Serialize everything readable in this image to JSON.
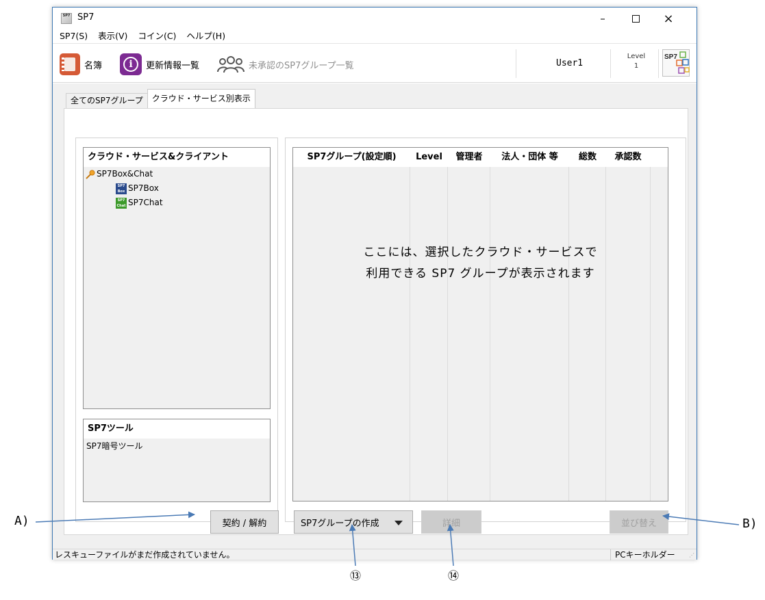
{
  "window": {
    "title": "SP7",
    "app_icon_text": "SP7",
    "controls": {
      "minimize": "–",
      "close": "×"
    }
  },
  "menu": [
    "SP7(S)",
    "表示(V)",
    "コイン(C)",
    "ヘルプ(H)"
  ],
  "toolbar": {
    "directory_label": "名簿",
    "updates_label": "更新情報一覧",
    "pending_groups_label": "未承認のSP7グループ一覧",
    "user_name": "User1",
    "level_label": "Level",
    "level_value": "1",
    "logo_text": "SP7"
  },
  "tabs": [
    "全てのSP7グループ",
    "クラウド・サービス別表示"
  ],
  "active_tab": 1,
  "services": {
    "header": "クラウド・サービス&クライアント",
    "root": "SP7Box&Chat",
    "children": [
      {
        "label": "SP7Box",
        "icon_text": "SP7 Box"
      },
      {
        "label": "SP7Chat",
        "icon_text": "SP7 Chat"
      }
    ]
  },
  "tools": {
    "header": "SP7ツール",
    "items": [
      "SP7暗号ツール"
    ]
  },
  "buttons": {
    "contract": "契約 / 解約",
    "create_group": "SP7グループの作成",
    "detail": "詳細",
    "sort": "並び替え"
  },
  "group_table": {
    "columns": [
      "SP7グループ(設定順)",
      "Level",
      "管理者",
      "法人・団体 等",
      "総数",
      "承認数"
    ],
    "empty_message_line1": "ここには、選択したクラウド・サービスで",
    "empty_message_line2": "利用できる SP7 グループが表示されます"
  },
  "status": {
    "message": "レスキューファイルがまだ作成されていません。",
    "keyholder": "PCキーホルダー"
  },
  "annotations": {
    "A": "A)",
    "B": "B)",
    "n13": "⑬",
    "n14": "⑭"
  },
  "colors": {
    "window_border": "#3c78b4",
    "arrow": "#4a7ab5",
    "directory_icon": "#d55a36",
    "info_icon": "#7c2a92"
  }
}
